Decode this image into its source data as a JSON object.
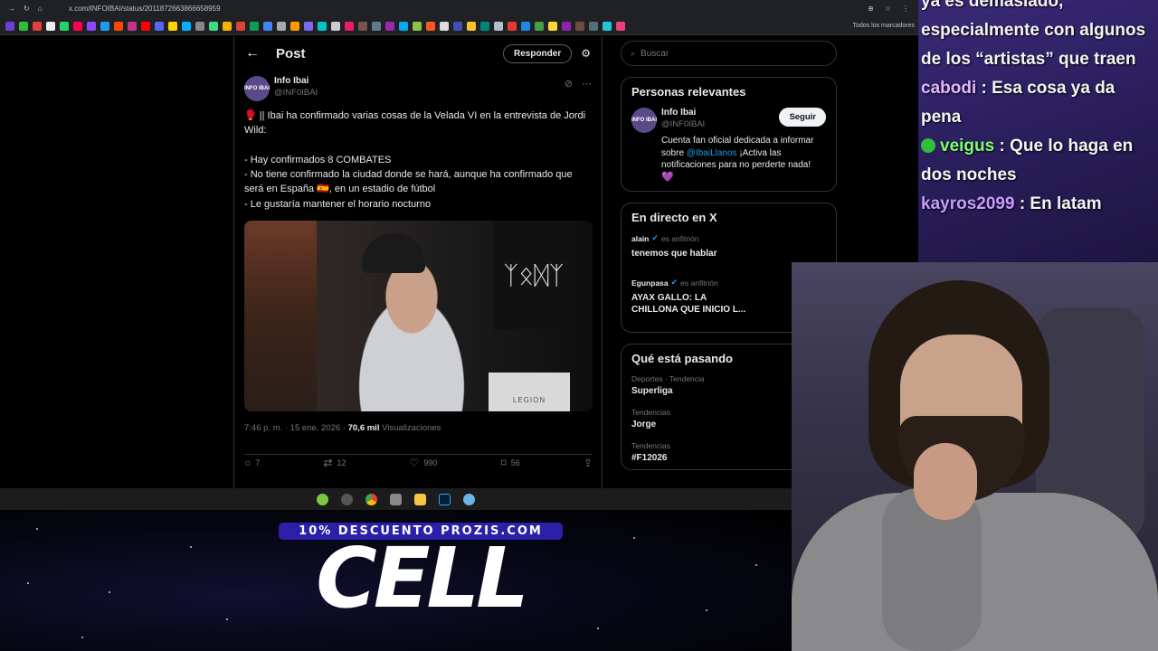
{
  "browser": {
    "url": "x.com/INFOIBAI/status/2011872663866658959",
    "bookmarks_folder": "Todos los marcadores"
  },
  "x": {
    "header": {
      "back": "←",
      "title": "Post",
      "reply_button": "Responder"
    },
    "author": {
      "name": "Info Ibai",
      "handle": "@INF0IBAI",
      "avatar_text": "INFO IBAI"
    },
    "tweet_text": "🥊 || Ibai ha confirmado varias cosas de la Velada VI en la entrevista de Jordi Wild:\n\n- Hay confirmados 8 COMBATES\n- No tiene confirmado la ciudad donde se hará, aunque ha confirmado que será en España 🇪🇸, en un estadio de fútbol\n- Le gustaría mantener el horario nocturno",
    "media": {
      "poster_text": "ᛉᛟᛞᛉ",
      "laptop_text": "LEGION"
    },
    "meta": {
      "time": "7:46 p. m. · 15 ene. 2026 · ",
      "views_count": "70,6 mil",
      "views_label": " Visualizaciones"
    },
    "actions": {
      "replies": "7",
      "reposts": "12",
      "likes": "990",
      "bookmarks": "56"
    },
    "search_placeholder": "Buscar",
    "relevant": {
      "title": "Personas relevantes",
      "name": "Info Ibai",
      "handle": "@INF0IBAI",
      "follow": "Seguir",
      "bio_pre": "Cuenta fan oficial dedicada a informar sobre ",
      "bio_link": "@IbaiLlanos",
      "bio_post": " ¡Activa las notificaciones para no perderte nada!",
      "bio_heart": "💜"
    },
    "live": {
      "title": "En directo en X",
      "items": [
        {
          "host": "alain",
          "role": "es anfitrión",
          "title": "tenemos que hablar"
        },
        {
          "host": "Egunpasa",
          "role": "es anfitrión",
          "title": "AYAX GALLO: LA CHILLONA QUE INICIO L..."
        }
      ]
    },
    "trends": {
      "title": "Qué está pasando",
      "items": [
        {
          "category": "Deportes · Tendencia",
          "name": "Superliga"
        },
        {
          "category": "Tendencias",
          "name": "Jorge"
        },
        {
          "category": "Tendencias",
          "name": "#F12026"
        }
      ]
    }
  },
  "promo": {
    "tag": "10% DESCUENTO PROZIS.COM",
    "big": "CELL"
  },
  "chat": {
    "line0": "ya es demasiado, especialmente con algunos de los “artistas” que traen",
    "messages": [
      {
        "user": "cabodi",
        "user_color": "#e3b6ff",
        "text": " : Esa cosa ya da pena"
      },
      {
        "user": "veigus",
        "user_color": "#7dff6e",
        "text": " : Que lo haga en dos noches"
      },
      {
        "user": "kayros2099",
        "user_color": "#c79bff",
        "text": " : En latam"
      }
    ]
  }
}
